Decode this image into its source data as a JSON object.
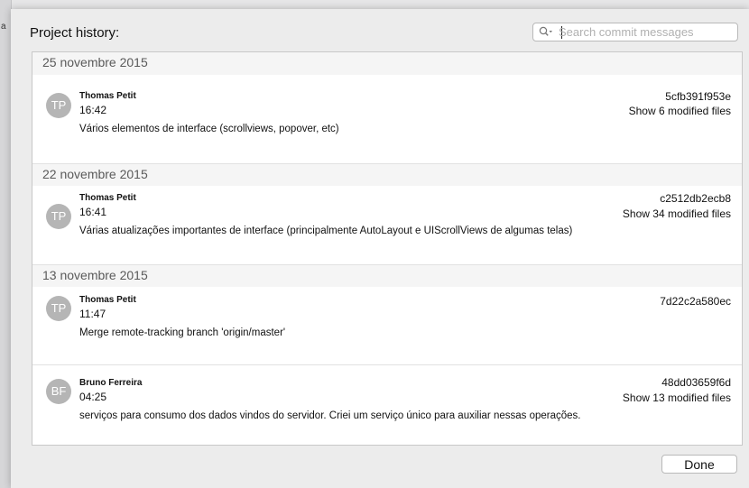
{
  "left_edge_glyph": "a",
  "dialog": {
    "title": "Project history:",
    "search": {
      "placeholder": "Search commit messages",
      "value": ""
    },
    "done_label": "Done"
  },
  "groups": [
    {
      "date": "25 novembre 2015",
      "commits": [
        {
          "initials": "TP",
          "author": "Thomas Petit",
          "time": "16:42",
          "hash": "5cfb391f953e",
          "files": "Show 6 modified files",
          "message": "Vários elementos de interface (scrollviews, popover, etc)"
        }
      ]
    },
    {
      "date": "22 novembre 2015",
      "commits": [
        {
          "initials": "TP",
          "author": "Thomas Petit",
          "time": "16:41",
          "hash": "c2512db2ecb8",
          "files": "Show 34 modified files",
          "message": "Várias atualizações importantes de interface (principalmente AutoLayout e UIScrollViews de algumas telas)"
        }
      ]
    },
    {
      "date": "13 novembre 2015",
      "commits": [
        {
          "initials": "TP",
          "author": "Thomas Petit",
          "time": "11:47",
          "hash": "7d22c2a580ec",
          "files": "",
          "message": "Merge remote-tracking branch 'origin/master'"
        },
        {
          "initials": "BF",
          "author": "Bruno Ferreira",
          "time": "04:25",
          "hash": "48dd03659f6d",
          "files": "Show 13 modified files",
          "message": "serviços para consumo dos dados vindos do servidor. Criei um serviço único para auxiliar nessas operações."
        }
      ]
    }
  ]
}
